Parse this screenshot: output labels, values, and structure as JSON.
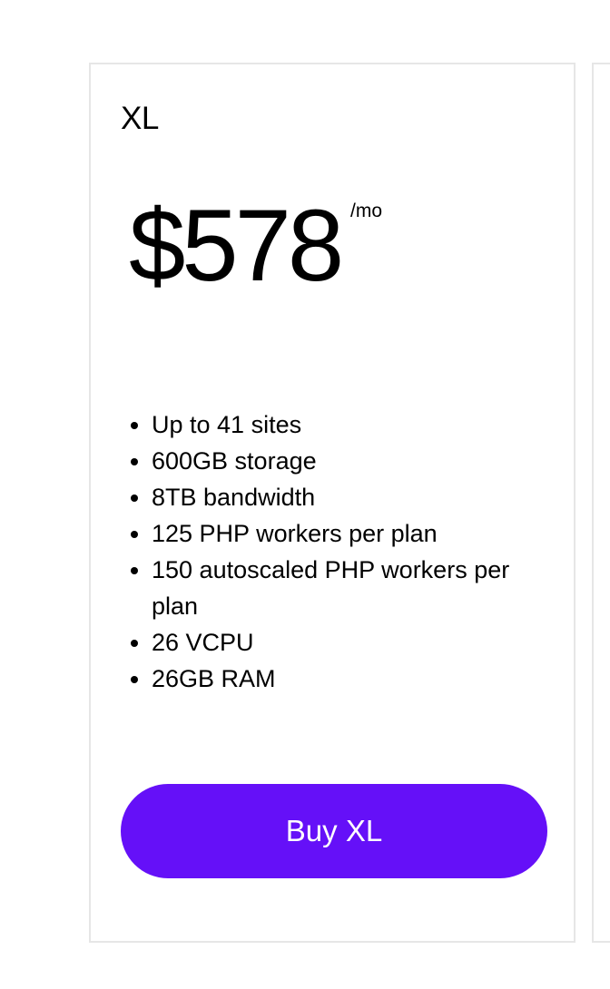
{
  "plan": {
    "name": "XL",
    "price": "$578",
    "period": "/mo",
    "features": [
      "Up to 41 sites",
      "600GB storage",
      "8TB bandwidth",
      "125 PHP workers per plan",
      "150 autoscaled PHP workers per plan",
      "26 VCPU",
      "26GB RAM"
    ],
    "button_label": "Buy XL"
  },
  "colors": {
    "button_background": "#6510f8",
    "button_text": "#ffffff",
    "card_border": "#e6e6e6",
    "text": "#000000"
  }
}
